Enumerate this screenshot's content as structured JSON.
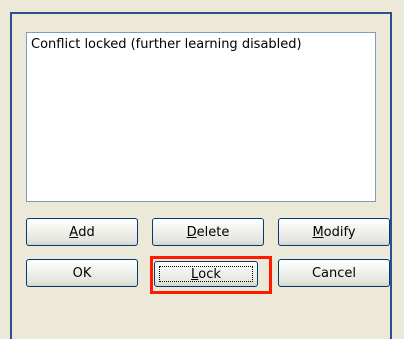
{
  "listbox": {
    "items": [
      "Conflict locked (further learning disabled)"
    ]
  },
  "buttons": {
    "add": {
      "accel": "A",
      "rest": "dd"
    },
    "delete": {
      "accel": "D",
      "rest": "elete"
    },
    "modify": {
      "accel": "M",
      "rest": "odify"
    },
    "ok": {
      "label": "OK"
    },
    "lock": {
      "accel": "L",
      "rest": "ock"
    },
    "cancel": {
      "label": "Cancel"
    }
  },
  "colors": {
    "frame_border": "#2c4f8f",
    "highlight": "#ff1a00",
    "dialog_bg": "#ece9d8"
  }
}
